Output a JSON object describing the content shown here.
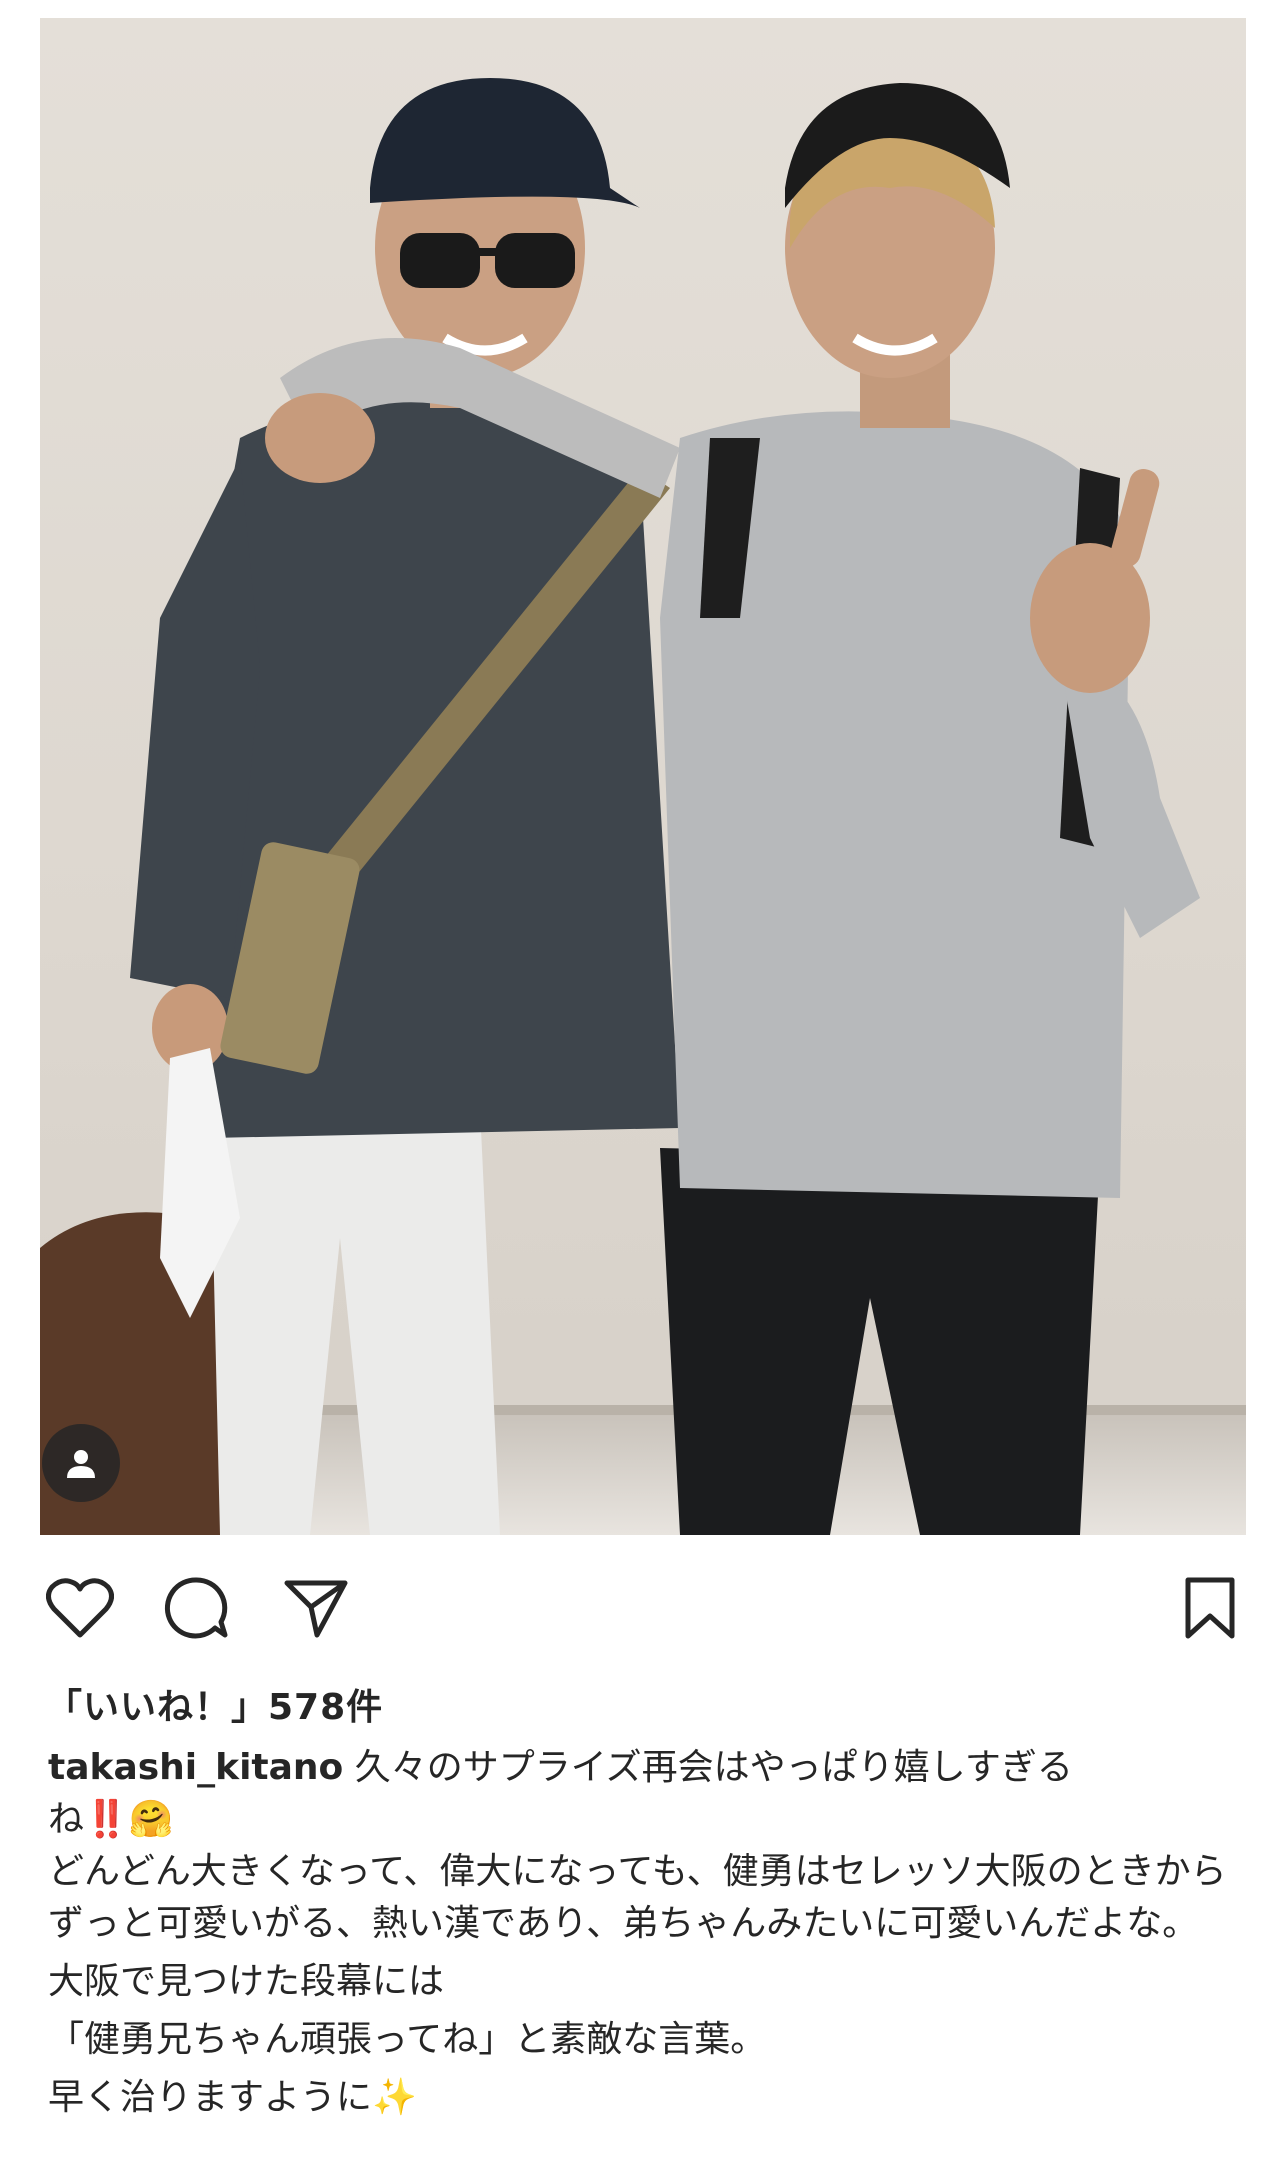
{
  "post": {
    "likes_text": "「いいね！」578件",
    "username": "takashi_kitano",
    "caption_first": " 久々のサプライズ再会はやっぱり嬉しすぎる",
    "caption_line2": "ね‼️🤗",
    "caption_para2": "どんどん大きくなって、偉大になっても、健勇はセレッソ大阪のときからずっと可愛いがる、熱い漢であり、弟ちゃんみたいに可愛いんだよな。",
    "caption_para3": "大阪で見つけた段幕には",
    "caption_para4": "「健勇兄ちゃん頑張ってね」と素敵な言葉。",
    "caption_para5": "早く治りますように✨"
  },
  "icons": {
    "like": "heart-icon",
    "comment": "comment-bubble-icon",
    "share": "paper-plane-icon",
    "save": "bookmark-icon",
    "tagged": "user-tag-icon"
  },
  "colors": {
    "text": "#262626",
    "background": "#ffffff"
  }
}
